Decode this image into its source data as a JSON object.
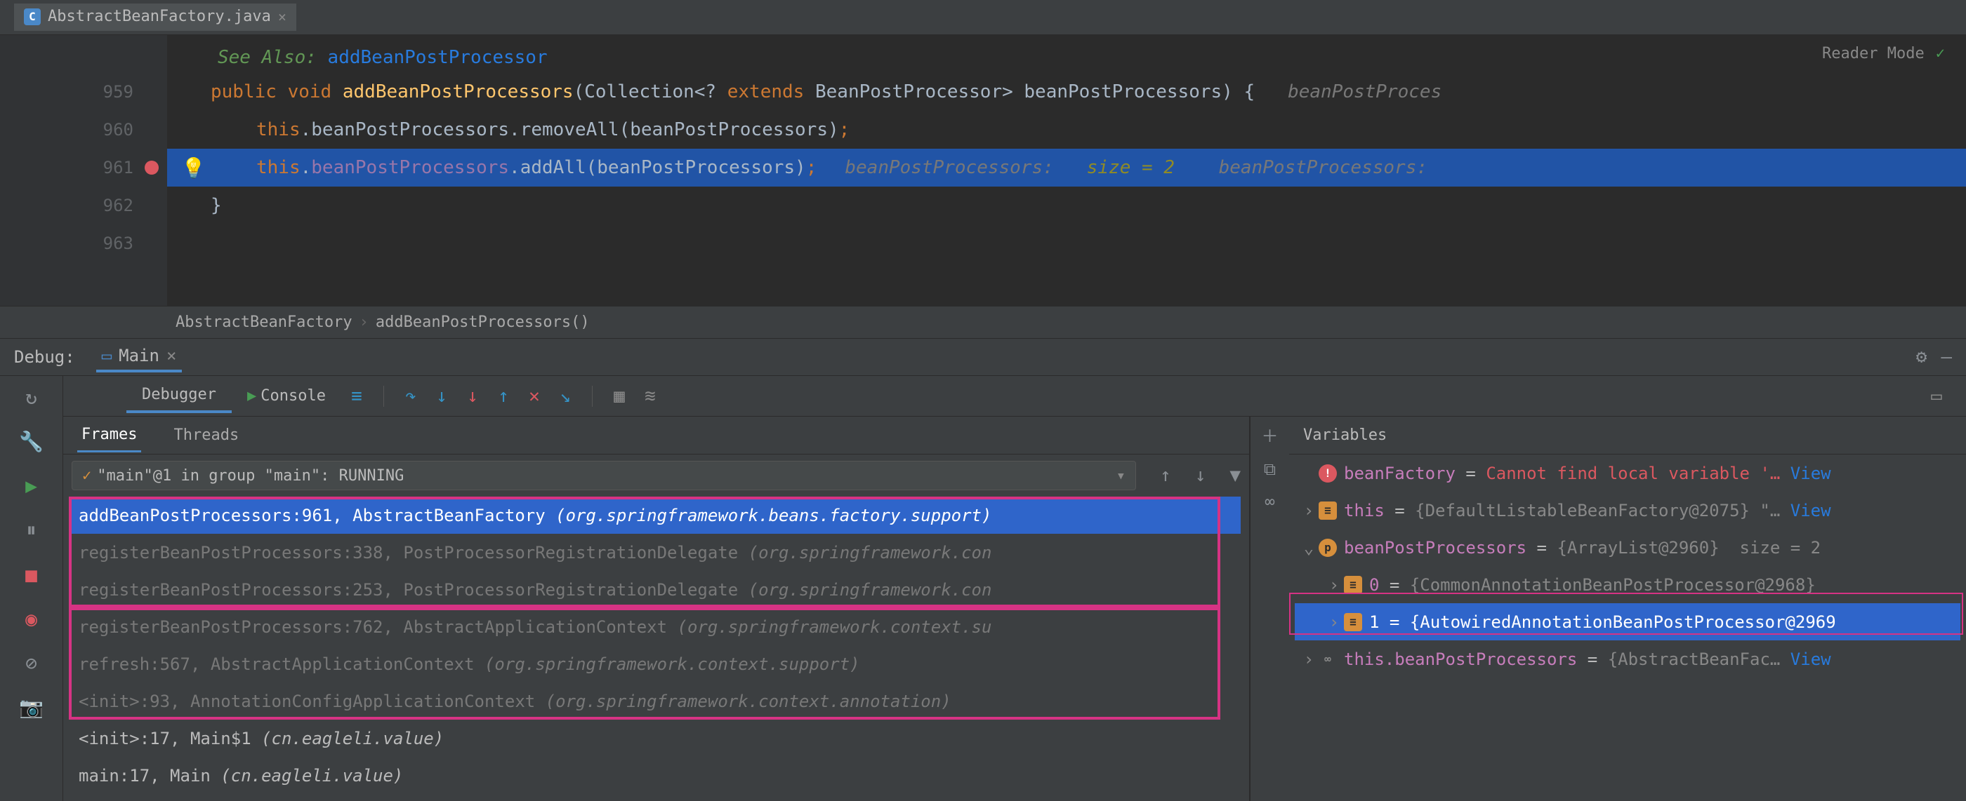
{
  "fileTab": {
    "name": "AbstractBeanFactory.java",
    "icon": "C"
  },
  "readerMode": "Reader Mode",
  "gutterLines": [
    "959",
    "960",
    "961",
    "962",
    "963"
  ],
  "code": {
    "seeAlso": "See Also: ",
    "seeAlsoLink": "addBeanPostProcessor",
    "l959_kw1": "public ",
    "l959_kw2": "void ",
    "l959_fn": "addBeanPostProcessors",
    "l959_sig1": "(Collection<? ",
    "l959_kw3": "extends ",
    "l959_sig2": "BeanPostProcessor> beanPostProcessors) {   ",
    "l959_hint": "beanPostProces",
    "l960_kw": "this",
    "l960_rest": ".beanPostProcessors.removeAll(beanPostProcessors)",
    "l960_semi": ";",
    "l961_kw": "this",
    "l961_dot": ".",
    "l961_field": "beanPostProcessors",
    "l961_dot2": ".",
    "l961_fn": "addAll",
    "l961_args": "(beanPostProcessors)",
    "l961_semi": ";",
    "l961_hint1": "beanPostProcessors:   ",
    "l961_hint2": "size = 2",
    "l961_hint3": "    beanPostProcessors: ",
    "l962": "}"
  },
  "breadcrumb": {
    "class": "AbstractBeanFactory",
    "method": "addBeanPostProcessors()"
  },
  "debug": {
    "title": "Debug:",
    "runConfig": "Main",
    "tabs": {
      "debugger": "Debugger",
      "console": "Console"
    },
    "paneTabs": {
      "frames": "Frames",
      "threads": "Threads",
      "variables": "Variables"
    },
    "threadSelector": "\"main\"@1 in group \"main\": RUNNING",
    "frames": [
      {
        "method": "addBeanPostProcessors:961, ",
        "cls": "AbstractBeanFactory ",
        "pkg": "(org.springframework.beans.factory.support)",
        "selected": true
      },
      {
        "method": "registerBeanPostProcessors:338, ",
        "cls": "PostProcessorRegistrationDelegate ",
        "pkg": "(org.springframework.con",
        "dimmed": true
      },
      {
        "method": "registerBeanPostProcessors:253, ",
        "cls": "PostProcessorRegistrationDelegate ",
        "pkg": "(org.springframework.con",
        "dimmed": true
      },
      {
        "method": "registerBeanPostProcessors:762, ",
        "cls": "AbstractApplicationContext ",
        "pkg": "(org.springframework.context.su",
        "dimmed": true
      },
      {
        "method": "refresh:567, ",
        "cls": "AbstractApplicationContext ",
        "pkg": "(org.springframework.context.support)",
        "dimmed": true
      },
      {
        "method": "<init>:93, ",
        "cls": "AnnotationConfigApplicationContext ",
        "pkg": "(org.springframework.context.annotation)",
        "dimmed": true
      },
      {
        "method": "<init>:17, ",
        "cls": "Main$1 ",
        "pkg": "(cn.eagleli.value)",
        "dimmed": false
      },
      {
        "method": "main:17, ",
        "cls": "Main ",
        "pkg": "(cn.eagleli.value)",
        "dimmed": false
      }
    ],
    "vars": [
      {
        "indent": 0,
        "exp": "",
        "icon": "stop",
        "iconSym": "!",
        "name": "beanFactory",
        "eq": " = ",
        "valClass": "var-err",
        "val": "Cannot find local variable '… ",
        "view": "View"
      },
      {
        "indent": 0,
        "exp": "›",
        "icon": "struct",
        "iconSym": "≡",
        "name": "this",
        "eq": " = ",
        "val": "{DefaultListableBeanFactory@2075} \"… ",
        "view": "View"
      },
      {
        "indent": 0,
        "exp": "⌄",
        "icon": "param",
        "iconSym": "p",
        "name": "beanPostProcessors",
        "eq": " = ",
        "val": "{ArrayList@2960}  size = 2"
      },
      {
        "indent": 1,
        "exp": "›",
        "icon": "struct",
        "iconSym": "≡",
        "name": "0",
        "eq": " = ",
        "val": "{CommonAnnotationBeanPostProcessor@2968}"
      },
      {
        "indent": 1,
        "exp": "›",
        "icon": "struct",
        "iconSym": "≡",
        "name": "1",
        "eq": " = ",
        "val": "{AutowiredAnnotationBeanPostProcessor@2969",
        "selected": true
      },
      {
        "indent": 0,
        "exp": "›",
        "icon": "field",
        "iconSym": "∞",
        "name": "this.beanPostProcessors",
        "eq": " = ",
        "val": "{AbstractBeanFac… ",
        "view": "View"
      }
    ]
  }
}
